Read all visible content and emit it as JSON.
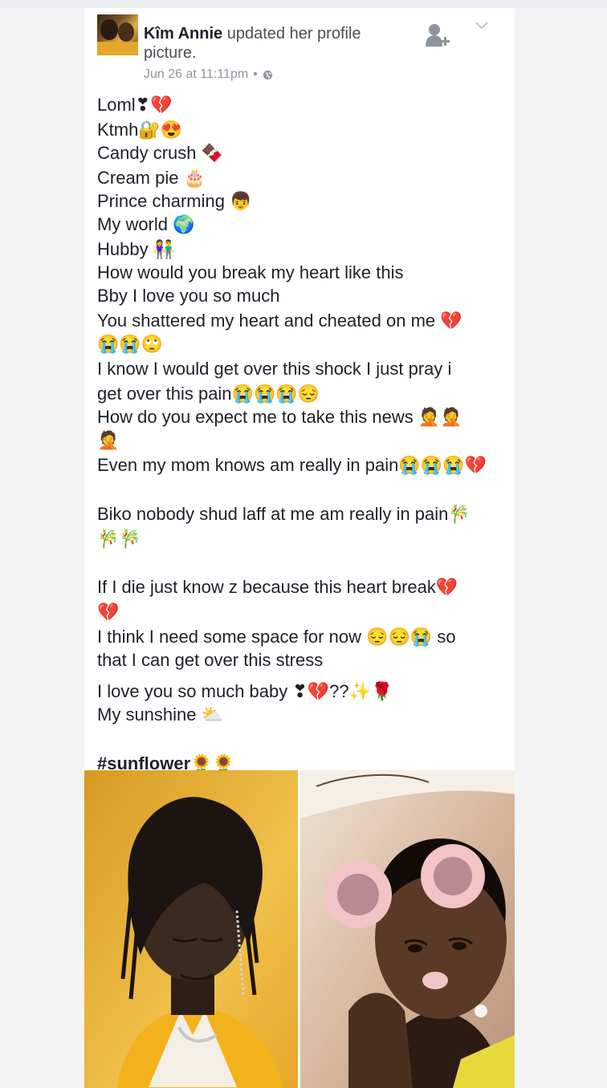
{
  "post": {
    "author": "Kîm Annie",
    "action": "updated her profile picture.",
    "timestamp": "Jun 26 at 11:11pm",
    "separator": "•"
  },
  "icons": {
    "privacy": "globe-icon",
    "add_friend": "add-friend-icon",
    "menu": "chevron-down-icon"
  },
  "lines": [
    "Loml❣💔",
    "Ktmh🔐😍",
    "Candy crush 🍫",
    "Cream pie 🎂",
    "Prince charming 👦",
    "My world 🌍",
    "Hubby 👫",
    "How would you break my heart like this",
    "Bby I love you so much",
    "You shattered my heart and cheated on me 💔",
    "😭😭🙄",
    "I know I would get over this shock I just pray i",
    "get over this pain😭😭😭😔",
    "How do you expect me to take this news 🤦🤦",
    "🤦",
    "Even my mom knows am really in pain😭😭😭💔",
    "Biko nobody shud laff at me am really in pain🎋",
    "🎋🎋",
    "If I die just know z because this heart break💔",
    "💔",
    "I think I need some space for now 😔😔😭 so",
    "that I can get over this stress",
    "I love you so much baby ❣💔??✨🌹",
    "My sunshine ⛅"
  ],
  "hashtag": "#sunflower🌻🌻",
  "colors": {
    "name": "#1d2129",
    "body_text": "#1d2129",
    "meta": "#90949c",
    "background": "#f4f4f4"
  }
}
